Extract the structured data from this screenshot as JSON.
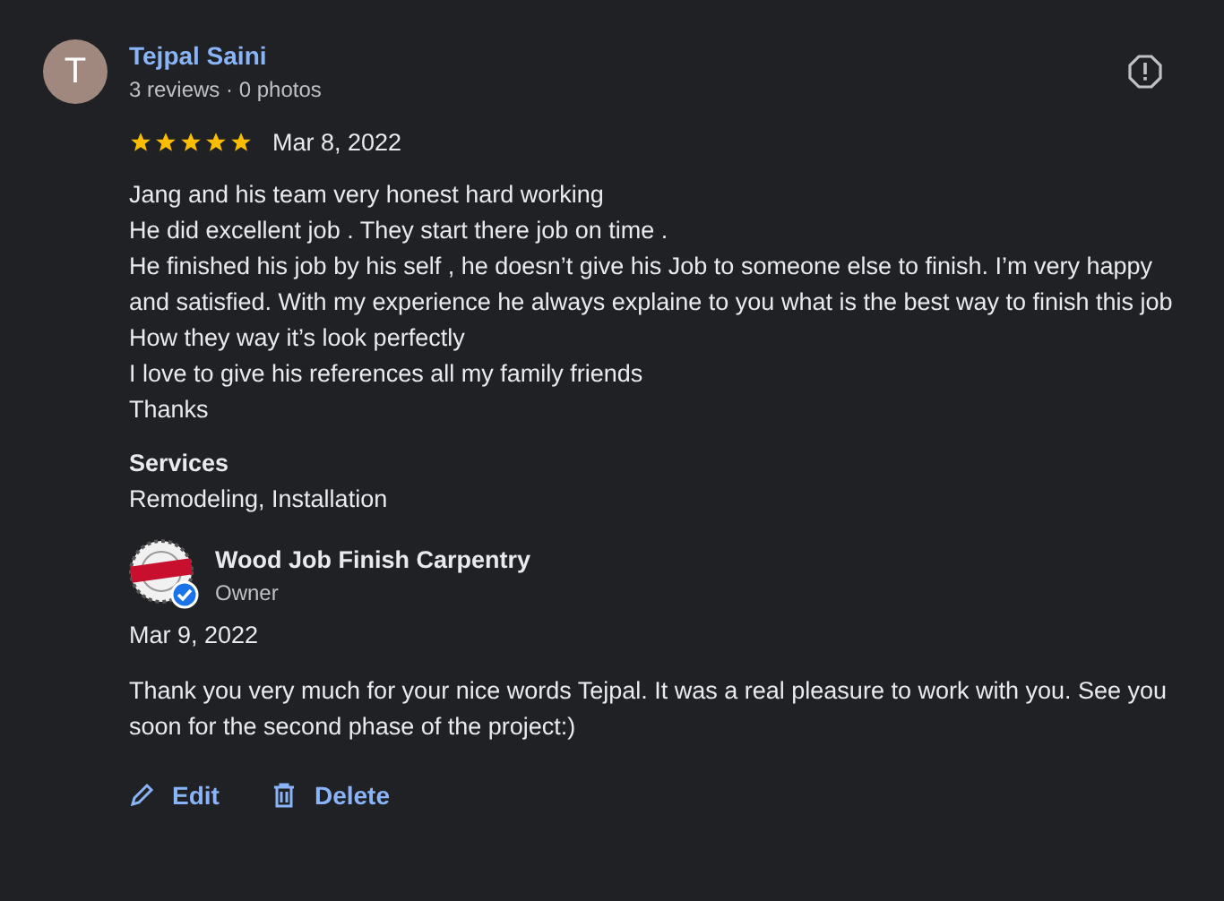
{
  "reviewer": {
    "initial": "T",
    "name": "Tejpal Saini",
    "meta": "3 reviews · 0 photos"
  },
  "review": {
    "stars": 5,
    "date": "Mar 8, 2022",
    "lines": [
      "Jang and his team very honest hard working",
      "He did excellent job . They start there job on time .",
      "He finished his job by his self , he doesn’t give his Job to someone else to finish. I’m very happy and satisfied. With my experience he always explaine to you what is the best way to finish this job",
      "How they way it’s look perfectly",
      "I love to give his references all my family friends",
      "Thanks"
    ]
  },
  "services": {
    "heading": "Services",
    "value": "Remodeling, Installation"
  },
  "owner_reply": {
    "name": "Wood Job Finish Carpentry",
    "role": "Owner",
    "date": "Mar 9, 2022",
    "text": "Thank you very much for your nice words Tejpal. It was a real pleasure to work with you. See you soon for the second phase of the project:)"
  },
  "actions": [
    {
      "kind": "edit",
      "label": "Edit"
    },
    {
      "kind": "delete",
      "label": "Delete"
    }
  ]
}
